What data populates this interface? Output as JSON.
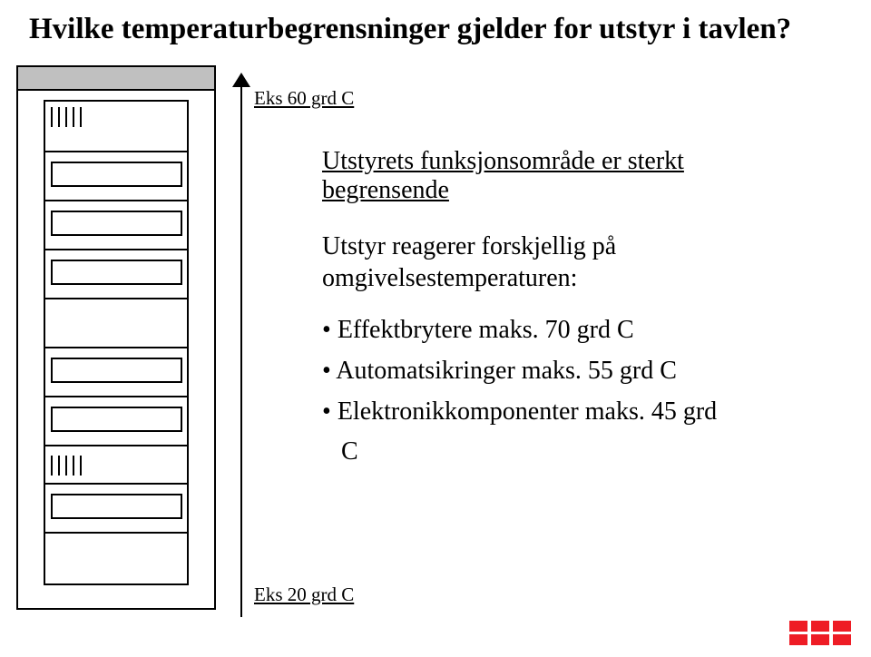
{
  "title": "Hvilke temperaturbegrensninger gjelder for utstyr i tavlen?",
  "labels": {
    "top": "Eks 60 grd C",
    "bottom": "Eks 20 grd C"
  },
  "subheading_line1": "Utstyrets funksjonsområde er sterkt",
  "subheading_line2": "begrensende",
  "body_line1": "Utstyr reagerer forskjellig på",
  "body_line2": "omgivelsestemperaturen:",
  "bullets": {
    "b1": "Effektbrytere maks. 70 grd C",
    "b2": "Automatsikringer maks. 55 grd C",
    "b3a": "Elektronikkomponenter maks. 45 grd",
    "b3b": "C"
  },
  "logo": "ABB"
}
